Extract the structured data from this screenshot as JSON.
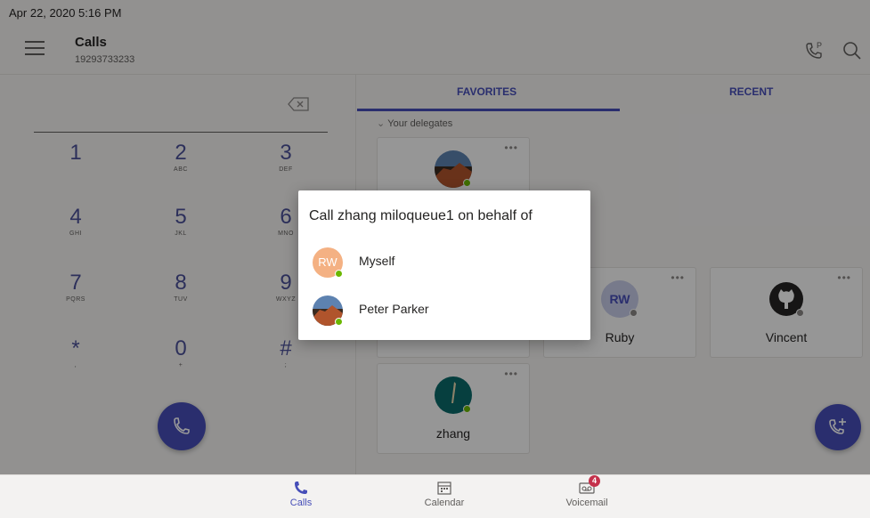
{
  "status_bar": {
    "datetime": "Apr 22, 2020  5:16 PM"
  },
  "header": {
    "title": "Calls",
    "subtitle": "19293733233",
    "icons": [
      "menu-icon",
      "park-call-icon",
      "search-icon"
    ]
  },
  "dialpad": {
    "keys": [
      {
        "num": "1",
        "letters": ""
      },
      {
        "num": "2",
        "letters": "ABC"
      },
      {
        "num": "3",
        "letters": "DEF"
      },
      {
        "num": "4",
        "letters": "GHI"
      },
      {
        "num": "5",
        "letters": "JKL"
      },
      {
        "num": "6",
        "letters": "MNO"
      },
      {
        "num": "7",
        "letters": "PQRS"
      },
      {
        "num": "8",
        "letters": "TUV"
      },
      {
        "num": "9",
        "letters": "WXYZ"
      },
      {
        "num": "*",
        "letters": ","
      },
      {
        "num": "0",
        "letters": "+"
      },
      {
        "num": "#",
        "letters": ";"
      }
    ]
  },
  "tabs": {
    "favorites": "FAVORITES",
    "recent": "RECENT"
  },
  "section": {
    "label": "Your delegates"
  },
  "cards": {
    "ruby": {
      "initials": "RW",
      "name": "Ruby"
    },
    "vincent": {
      "name": "Vincent"
    },
    "zhang": {
      "name": "zhang"
    },
    "more": "•••"
  },
  "dialog": {
    "title": "Call zhang miloqueue1 on behalf of",
    "options": [
      {
        "label": "Myself",
        "initials": "RW"
      },
      {
        "label": "Peter Parker"
      }
    ]
  },
  "bottom_nav": {
    "calls": "Calls",
    "calendar": "Calendar",
    "voicemail": "Voicemail",
    "voicemail_badge": "4"
  },
  "colors": {
    "accent": "#464eb8",
    "presence_available": "#6bb700",
    "badge": "#c4314b"
  }
}
